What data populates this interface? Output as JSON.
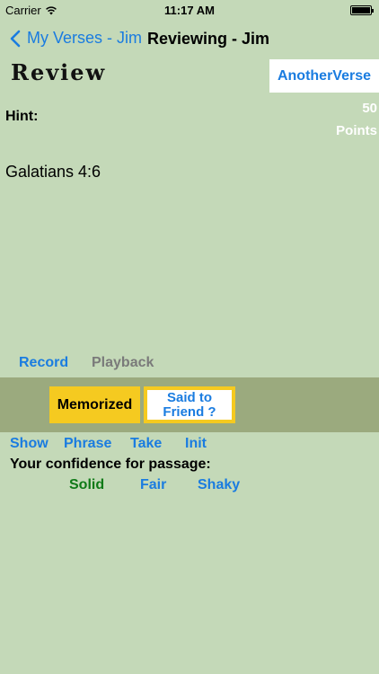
{
  "status_bar": {
    "carrier": "Carrier",
    "time": "11:17 AM",
    "wifi_icon": "wifi-icon",
    "battery_icon": "battery-icon"
  },
  "nav": {
    "back_label": "My Verses - Jim",
    "back_icon": "chevron-back-icon",
    "title": "Reviewing - Jim"
  },
  "review": {
    "heading": "Review",
    "another_verse": "AnotherVerse",
    "hint_label": "Hint:",
    "points_value": "50",
    "points_label": "Points",
    "reference": "Galatians 4:6"
  },
  "audio": {
    "record": "Record",
    "playback": "Playback"
  },
  "actions": {
    "memorized": "Memorized",
    "said_to_friend": "Said to Friend ?"
  },
  "tabs": {
    "show": "Show",
    "phrase": "Phrase",
    "take": "Take",
    "init": "Init"
  },
  "confidence": {
    "label": "Your confidence for passage:",
    "solid": "Solid",
    "fair": "Fair",
    "shaky": "Shaky"
  },
  "colors": {
    "background": "#c4d9b8",
    "accent_blue": "#1a7ce0",
    "action_band": "#9baa7e",
    "button_yellow": "#f5ca20",
    "solid_green": "#0f7a17"
  }
}
